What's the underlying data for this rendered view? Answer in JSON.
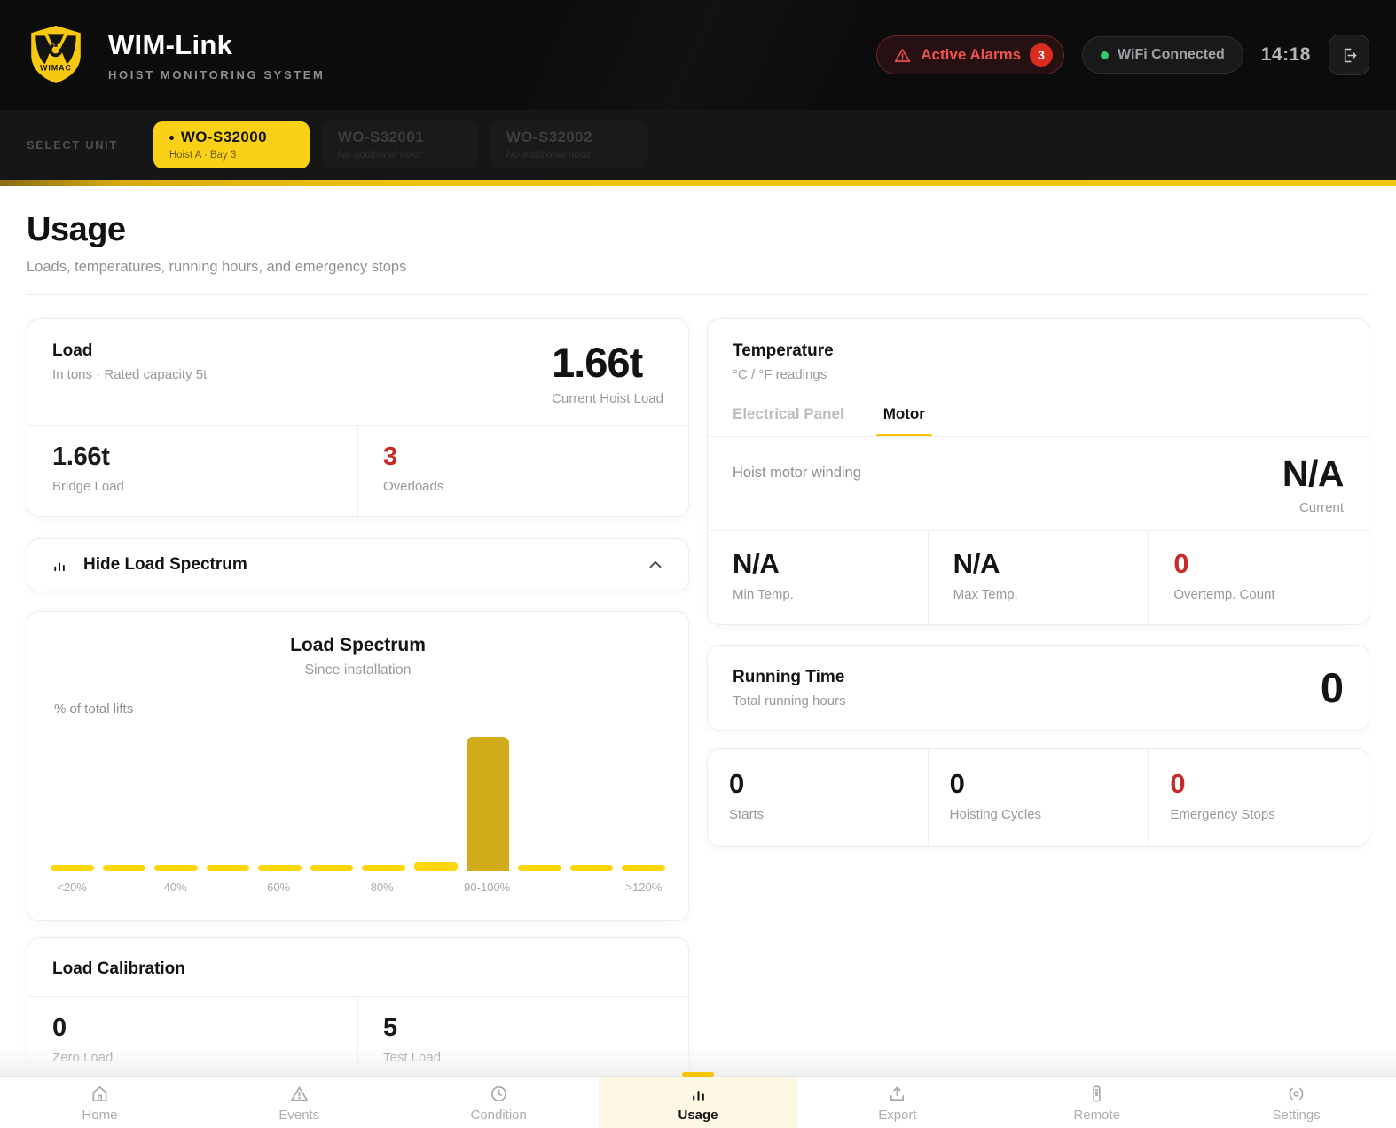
{
  "header": {
    "app_title": "WIM-Link",
    "app_subtitle": "HOIST MONITORING SYSTEM",
    "alarms": {
      "label": "Active Alarms",
      "count": "3"
    },
    "wifi_label": "WiFi Connected",
    "time": "14:18"
  },
  "unit_selector": {
    "label": "SELECT UNIT",
    "units": [
      {
        "name": "WO-S32000",
        "detail": "Hoist A · Bay 3",
        "active": true
      },
      {
        "name": "WO-S32001",
        "detail": "No additional hoist",
        "active": false
      },
      {
        "name": "WO-S32002",
        "detail": "No additional hoist",
        "active": false
      }
    ]
  },
  "page": {
    "title": "Usage",
    "subtitle": "Loads, temperatures, running hours, and emergency stops"
  },
  "load": {
    "title": "Load",
    "subtitle": "In tons · Rated capacity 5t",
    "current_value": "1.66t",
    "current_label": "Current Hoist Load",
    "bridge_value": "1.66t",
    "bridge_label": "Bridge Load",
    "overloads_value": "3",
    "overloads_label": "Overloads"
  },
  "spectrum_toggle": {
    "label": "Hide Load Spectrum"
  },
  "chart_data": {
    "type": "bar",
    "title": "Load Spectrum",
    "subtitle": "Since installation",
    "ylabel": "% of total lifts",
    "xlabel": "",
    "categories": [
      "<20%",
      "",
      "40%",
      "",
      "60%",
      "",
      "80%",
      "",
      "90-100%",
      "",
      "",
      ">120%"
    ],
    "values": [
      0,
      0,
      0,
      0,
      0,
      0,
      0,
      6,
      90,
      0,
      0,
      0
    ],
    "ylim": [
      0,
      100
    ],
    "grid": false,
    "legend": false,
    "bar_color": "#FFD60A",
    "peak_bar_color": "#D1AC1B"
  },
  "calibration": {
    "title": "Load Calibration",
    "zero_value": "0",
    "zero_label": "Zero Load",
    "test_value": "5",
    "test_label": "Test Load"
  },
  "temperature": {
    "title": "Temperature",
    "subtitle": "°C / °F readings",
    "tabs": [
      "Electrical Panel",
      "Motor"
    ],
    "active_tab": "Motor",
    "winding_label": "Hoist motor winding",
    "winding_value": "N/A",
    "winding_caption": "Current",
    "min_value": "N/A",
    "min_label": "Min Temp.",
    "max_value": "N/A",
    "max_label": "Max Temp.",
    "overtemp_value": "0",
    "overtemp_label": "Overtemp. Count"
  },
  "running_time": {
    "title": "Running Time",
    "subtitle": "Total running hours",
    "value": "0"
  },
  "usage_stats": {
    "starts_value": "0",
    "starts_label": "Starts",
    "cycles_value": "0",
    "cycles_label": "Hoisting Cycles",
    "estops_value": "0",
    "estops_label": "Emergency Stops"
  },
  "bottom_nav": {
    "active": "Usage",
    "items": [
      {
        "label": "Home",
        "icon": "home-icon",
        "active": false
      },
      {
        "label": "Events",
        "icon": "warning-triangle-icon",
        "active": false
      },
      {
        "label": "Condition",
        "icon": "clock-icon",
        "active": false
      },
      {
        "label": "Usage",
        "icon": "bar-chart-icon",
        "active": true
      },
      {
        "label": "Export",
        "icon": "export-icon",
        "active": false
      },
      {
        "label": "Remote",
        "icon": "remote-icon",
        "active": false
      },
      {
        "label": "Settings",
        "icon": "settings-icon",
        "active": false
      }
    ]
  },
  "colors": {
    "accent_yellow": "#FBD117",
    "chart_bar_yellow": "#FFD60A",
    "chart_peak_yellow": "#D1AC1B",
    "alert_red": "#C52B27",
    "alarm_text_red": "#EF5350",
    "wifi_green": "#2FCB6E"
  }
}
